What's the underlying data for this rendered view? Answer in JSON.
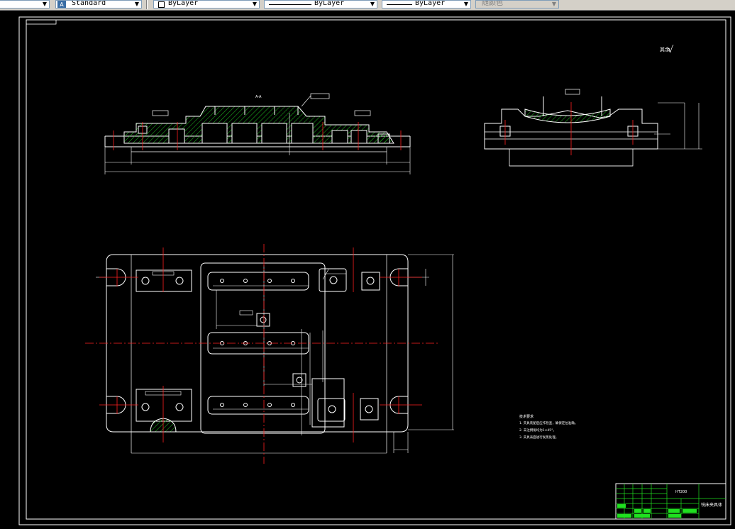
{
  "toolbar": {
    "text_style": "Standard",
    "layer": "ByLayer",
    "linetype": "ByLayer",
    "lineweight": "ByLayer",
    "color": "随颜色"
  },
  "drawing": {
    "section_label": "A-A",
    "roughness_note": "√",
    "tech_req_title": "技术要求",
    "tech_req_items": [
      "1. 夹具装配后应作检查，确保定位准确。",
      "2. 未注倒角均为1×45°。",
      "3. 夹具表面进行发黑处理。"
    ],
    "title_block_name": "铣床夹具体",
    "title_block_material": "HT200"
  },
  "colors": {
    "lines": "#ffffff",
    "centerline": "#ff2020",
    "hatch": "#20c020",
    "dimension": "#ffffff",
    "title_block": "#20e020"
  }
}
